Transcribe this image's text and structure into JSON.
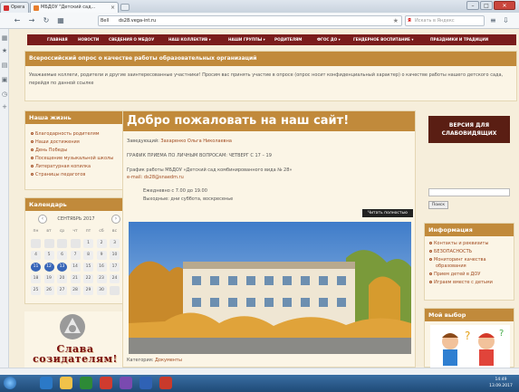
{
  "browser": {
    "tabs": [
      {
        "label": "Opera"
      },
      {
        "label": "МБДОУ \"Детский сад..."
      }
    ],
    "url_badge": "Bell",
    "url": "ds28.vega-int.ru",
    "search_placeholder": "Искать в Яндекс",
    "search_logo": "Я"
  },
  "nav": {
    "items": [
      "ГЛАВНАЯ",
      "НОВОСТИ",
      "СВЕДЕНИЯ О МБДОУ",
      "НАШ КОЛЛЕКТИВ ▾",
      "НАШИ ГРУППЫ ▾",
      "РОДИТЕЛЯМ",
      "ФГОС ДО ▾",
      "ГЕНДЕРНОЕ ВОСПИТАНИЕ ▾",
      "ПРАЗДНИКИ И ТРАДИЦИИ"
    ]
  },
  "survey": {
    "title": "Всероссийский опрос о качестве работы образовательных организаций",
    "text": "Уважаемые коллеги, родители и другие заинтересованные участники! Просим вас принять участие в опросе (опрос носит конфиденциальный характер) о качестве работы нашего детского сада, перейдя по данной ссылке"
  },
  "our_life": {
    "title": "Наша жизнь",
    "items": [
      "Благодарность родителям",
      "Наши достижения",
      "День Победы",
      "Посещение музыкальной школы",
      "Литературная копилка",
      "Страницы педагогов"
    ]
  },
  "calendar": {
    "title": "Календарь",
    "month": "СЕНТЯБРЬ 2017",
    "prev": "‹",
    "next": "›",
    "day_names": [
      "пн",
      "вт",
      "ср",
      "чт",
      "пт",
      "сб",
      "вс"
    ],
    "weeks": [
      [
        "",
        "",
        "",
        "",
        "1",
        "2",
        "3"
      ],
      [
        "4",
        "5",
        "6",
        "7",
        "8",
        "9",
        "10"
      ],
      [
        "11",
        "12",
        "13",
        "14",
        "15",
        "16",
        "17"
      ],
      [
        "18",
        "19",
        "20",
        "21",
        "22",
        "23",
        "24"
      ],
      [
        "25",
        "26",
        "27",
        "28",
        "29",
        "30",
        ""
      ]
    ],
    "highlighted": [
      "11",
      "12",
      "13"
    ]
  },
  "slava": {
    "text": "Слава созидателям!"
  },
  "main": {
    "welcome": "Добро пожаловать на наш сайт!",
    "head_label": "Заведующий:",
    "head_name": "Захаренко Ольга Николаевна",
    "schedule": "ГРАФИК ПРИЕМА ПО ЛИЧНЫМ ВОПРОСАМ: ЧЕТВЕРГ С 17 – 19",
    "work_schedule": "График работы МБДОУ «Детский сад комбинированного вида № 28»",
    "email": "e-mail: ds28@snaedm.ru",
    "daily": "Ежедневно с 7.00 до 19.00",
    "weekend": "Выходные: дни суббота, воскресенье",
    "read_more": "Читать полностью",
    "category_label": "Категория:",
    "category_value": "Документы"
  },
  "right": {
    "vision_line1": "ВЕРСИЯ ДЛЯ",
    "vision_line2": "СЛАБОВИДЯЩИХ",
    "search_button": "Поиск",
    "info_title": "Информация",
    "info_items": [
      "Контакты и реквизиты",
      "БЕЗОПАСНОСТЬ",
      "Мониторинг качества",
      "образования",
      "Прием детей в ДОУ",
      "Играем вместе с детьми"
    ],
    "choice_title": "Мой выбор"
  },
  "taskbar": {
    "time": "14:49",
    "date": "13.09.2017"
  },
  "colors": {
    "nav_bg": "#7a1c1c",
    "header_bg": "#c18a3b",
    "page_bg": "#f6eedb",
    "link": "#a04a1f"
  }
}
